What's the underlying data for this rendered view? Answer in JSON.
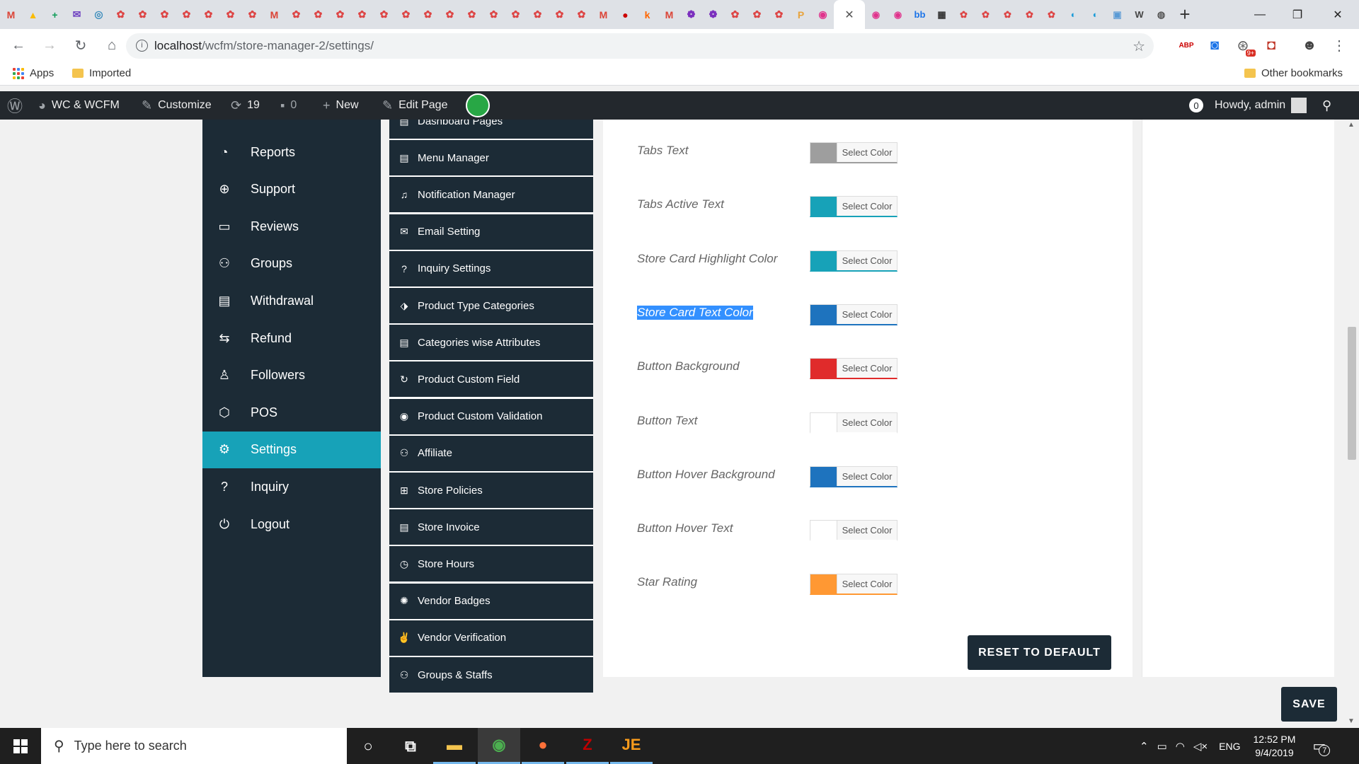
{
  "browser": {
    "tabs": [
      {
        "color": "#db4437",
        "glyph": "M"
      },
      {
        "color": "#fbbc04",
        "glyph": "▲"
      },
      {
        "color": "#0f9d58",
        "glyph": "+"
      },
      {
        "color": "#6f42c1",
        "glyph": "✉"
      },
      {
        "color": "#3c8dbc",
        "glyph": "◎"
      },
      {
        "color": "#d44",
        "glyph": "✿"
      },
      {
        "color": "#d44",
        "glyph": "✿"
      },
      {
        "color": "#d44",
        "glyph": "✿"
      },
      {
        "color": "#d44",
        "glyph": "✿"
      },
      {
        "color": "#d44",
        "glyph": "✿"
      },
      {
        "color": "#d44",
        "glyph": "✿"
      },
      {
        "color": "#d44",
        "glyph": "✿"
      },
      {
        "color": "#db4437",
        "glyph": "M"
      },
      {
        "color": "#d44",
        "glyph": "✿"
      },
      {
        "color": "#d44",
        "glyph": "✿"
      },
      {
        "color": "#d44",
        "glyph": "✿"
      },
      {
        "color": "#d44",
        "glyph": "✿"
      },
      {
        "color": "#d44",
        "glyph": "✿"
      },
      {
        "color": "#d44",
        "glyph": "✿"
      },
      {
        "color": "#d44",
        "glyph": "✿"
      },
      {
        "color": "#d44",
        "glyph": "✿"
      },
      {
        "color": "#d44",
        "glyph": "✿"
      },
      {
        "color": "#d44",
        "glyph": "✿"
      },
      {
        "color": "#d44",
        "glyph": "✿"
      },
      {
        "color": "#d44",
        "glyph": "✿"
      },
      {
        "color": "#d44",
        "glyph": "✿"
      },
      {
        "color": "#d44",
        "glyph": "✿"
      },
      {
        "color": "#db4437",
        "glyph": "M"
      },
      {
        "color": "#c00",
        "glyph": "●"
      },
      {
        "color": "#f60",
        "glyph": "k"
      },
      {
        "color": "#db4437",
        "glyph": "M"
      },
      {
        "color": "#7b2fbe",
        "glyph": "❁"
      },
      {
        "color": "#7b2fbe",
        "glyph": "❁"
      },
      {
        "color": "#d44",
        "glyph": "✿"
      },
      {
        "color": "#d44",
        "glyph": "✿"
      },
      {
        "color": "#d44",
        "glyph": "✿"
      },
      {
        "color": "#e8a33c",
        "glyph": "P"
      },
      {
        "color": "#e0338c",
        "glyph": "◉"
      }
    ],
    "active_tab_close": "✕",
    "tabs_after": [
      {
        "color": "#e0338c",
        "glyph": "◉"
      },
      {
        "color": "#e0338c",
        "glyph": "◉"
      },
      {
        "color": "#1a73e8",
        "glyph": "bb"
      },
      {
        "color": "#333",
        "glyph": "▦"
      },
      {
        "color": "#d44",
        "glyph": "✿"
      },
      {
        "color": "#d44",
        "glyph": "✿"
      },
      {
        "color": "#d44",
        "glyph": "✿"
      },
      {
        "color": "#d44",
        "glyph": "✿"
      },
      {
        "color": "#d44",
        "glyph": "✿"
      },
      {
        "color": "#1a9bd8",
        "glyph": "◐"
      },
      {
        "color": "#1a9bd8",
        "glyph": "◐"
      },
      {
        "color": "#5b9bd5",
        "glyph": "▣"
      },
      {
        "color": "#444",
        "glyph": "W"
      },
      {
        "color": "#555",
        "glyph": "◍"
      }
    ],
    "new_tab": "+",
    "window_controls": {
      "minimize": "—",
      "restore": "❐",
      "close": "✕"
    },
    "url_host": "localhost",
    "url_path": "/wcfm/store-manager-2/settings/",
    "bookmarks": {
      "apps": "Apps",
      "imported": "Imported",
      "other": "Other bookmarks"
    },
    "extensions": [
      {
        "name": "abp-icon",
        "color": "#c00",
        "glyph": "ABP"
      },
      {
        "name": "camera-icon",
        "color": "#1a73e8",
        "glyph": "◙"
      },
      {
        "name": "extension-badge-icon",
        "color": "#555",
        "glyph": "⊛",
        "badge": "9+"
      },
      {
        "name": "pocket-icon",
        "color": "#c0392b",
        "glyph": "◘"
      },
      {
        "name": "avatar-icon",
        "color": "#444",
        "glyph": "☻"
      },
      {
        "name": "menu-icon",
        "color": "#5f6368",
        "glyph": "⋮"
      }
    ]
  },
  "adminbar": {
    "site_name": "WC & WCFM",
    "customize": "Customize",
    "updates_count": "19",
    "comments_count": "0",
    "new_label": "New",
    "edit_page": "Edit Page",
    "notif_count": "0",
    "howdy": "Howdy, admin"
  },
  "sidebar": {
    "items": [
      {
        "label": "Reports",
        "icon": "◔",
        "name": "reports"
      },
      {
        "label": "Support",
        "icon": "⊕",
        "name": "support"
      },
      {
        "label": "Reviews",
        "icon": "▭",
        "name": "reviews"
      },
      {
        "label": "Groups",
        "icon": "⚇",
        "name": "groups"
      },
      {
        "label": "Withdrawal",
        "icon": "▤",
        "name": "withdrawal"
      },
      {
        "label": "Refund",
        "icon": "⇆",
        "name": "refund"
      },
      {
        "label": "Followers",
        "icon": "♙",
        "name": "followers"
      },
      {
        "label": "POS",
        "icon": "⬡",
        "name": "pos"
      },
      {
        "label": "Settings",
        "icon": "⚙",
        "name": "settings",
        "active": true
      },
      {
        "label": "Inquiry",
        "icon": "?",
        "name": "inquiry"
      },
      {
        "label": "Logout",
        "icon": "⏻",
        "name": "logout"
      }
    ]
  },
  "submenu": {
    "items": [
      {
        "label": "Dashboard Pages",
        "icon": "▤",
        "name": "dashboard-pages"
      },
      {
        "label": "Menu Manager",
        "icon": "▤",
        "name": "menu-manager"
      },
      {
        "label": "Notification Manager",
        "icon": "♫",
        "name": "notification-manager"
      },
      {
        "label": "Email Setting",
        "icon": "✉",
        "name": "email-setting"
      },
      {
        "label": "Inquiry Settings",
        "icon": "?",
        "name": "inquiry-settings"
      },
      {
        "label": "Product Type Categories",
        "icon": "⬗",
        "name": "product-type-categories"
      },
      {
        "label": "Categories wise Attributes",
        "icon": "▤",
        "name": "categories-wise-attributes"
      },
      {
        "label": "Product Custom Field",
        "icon": "↻",
        "name": "product-custom-field"
      },
      {
        "label": "Product Custom Validation",
        "icon": "◉",
        "name": "product-custom-validation"
      },
      {
        "label": "Affiliate",
        "icon": "⚇",
        "name": "affiliate"
      },
      {
        "label": "Store Policies",
        "icon": "⊞",
        "name": "store-policies"
      },
      {
        "label": "Store Invoice",
        "icon": "▤",
        "name": "store-invoice"
      },
      {
        "label": "Store Hours",
        "icon": "◷",
        "name": "store-hours"
      },
      {
        "label": "Vendor Badges",
        "icon": "✺",
        "name": "vendor-badges"
      },
      {
        "label": "Vendor Verification",
        "icon": "✌",
        "name": "vendor-verification"
      },
      {
        "label": "Groups & Staffs",
        "icon": "⚇",
        "name": "groups-staffs"
      }
    ]
  },
  "color_settings": {
    "picker_label": "Select Color",
    "fields": [
      {
        "label": "Tabs Text",
        "color": "#9e9e9e",
        "name": "tabs-text"
      },
      {
        "label": "Tabs Active Text",
        "color": "#17a2b8",
        "name": "tabs-active-text"
      },
      {
        "label": "Store Card Highlight Color",
        "color": "#17a2b8",
        "name": "store-card-highlight-color"
      },
      {
        "label": "Store Card Text Color",
        "color": "#1e73be",
        "name": "store-card-text-color",
        "selected": true
      },
      {
        "label": "Button Background",
        "color": "#e02b2b",
        "name": "button-background"
      },
      {
        "label": "Button Text",
        "color": "#ffffff",
        "name": "button-text"
      },
      {
        "label": "Button Hover Background",
        "color": "#1e73be",
        "name": "button-hover-background"
      },
      {
        "label": "Button Hover Text",
        "color": "#ffffff",
        "name": "button-hover-text"
      },
      {
        "label": "Star Rating",
        "color": "#ff9833",
        "name": "star-rating"
      }
    ],
    "reset_label": "RESET TO DEFAULT"
  },
  "save_label": "SAVE",
  "taskbar": {
    "search_placeholder": "Type here to search",
    "apps": [
      {
        "name": "cortana",
        "glyph": "○",
        "color": "#fff"
      },
      {
        "name": "task-view",
        "glyph": "⧉",
        "color": "#fff"
      },
      {
        "name": "file-explorer",
        "glyph": "▬",
        "color": "#f4c44e"
      },
      {
        "name": "chrome",
        "glyph": "◉",
        "color": "#4caf50"
      },
      {
        "name": "firefox",
        "glyph": "●",
        "color": "#ff7139"
      },
      {
        "name": "filezilla",
        "glyph": "Z",
        "color": "#bf0000"
      },
      {
        "name": "jetbrains",
        "glyph": "JE",
        "color": "#f89b1c"
      }
    ],
    "language": "ENG",
    "time": "12:52 PM",
    "date": "9/4/2019",
    "notification_count": "7"
  }
}
